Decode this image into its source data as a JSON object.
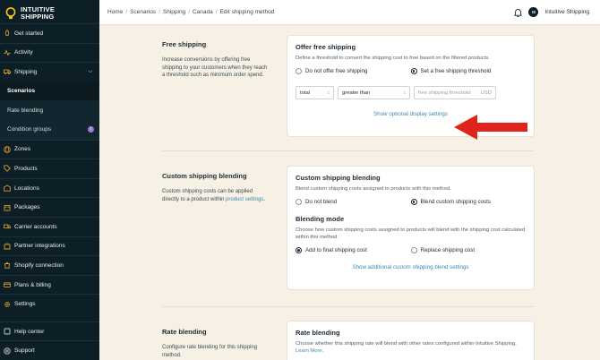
{
  "brand": {
    "line1": "INTUITIVE",
    "line2": "SHIPPING"
  },
  "sidebar": {
    "items": [
      {
        "label": "Get started",
        "icon": "rocket-icon"
      },
      {
        "label": "Activity",
        "icon": "activity-icon"
      },
      {
        "label": "Shipping",
        "icon": "truck-icon"
      }
    ],
    "sub_items": [
      {
        "label": "Scenarios"
      },
      {
        "label": "Rate blending"
      },
      {
        "label": "Condition groups",
        "badge": "i"
      }
    ],
    "items2": [
      {
        "label": "Zones",
        "icon": "globe-icon"
      },
      {
        "label": "Products",
        "icon": "tag-icon"
      },
      {
        "label": "Locations",
        "icon": "warehouse-icon"
      },
      {
        "label": "Packages",
        "icon": "box-icon"
      },
      {
        "label": "Carrier accounts",
        "icon": "truck-icon"
      },
      {
        "label": "Partner integrations",
        "icon": "puzzle-icon"
      },
      {
        "label": "Shopify connection",
        "icon": "shopify-icon"
      },
      {
        "label": "Plans & billing",
        "icon": "card-icon"
      },
      {
        "label": "Settings",
        "icon": "gear-icon"
      }
    ],
    "bottom": [
      {
        "label": "Help center",
        "icon": "help-icon"
      },
      {
        "label": "Support",
        "icon": "support-icon"
      }
    ]
  },
  "breadcrumb": [
    "Home",
    "Scenarios",
    "Shipping",
    "Canada",
    "Edit shipping method"
  ],
  "user": {
    "initials": "IS",
    "name": "Intuitive Shipping"
  },
  "free_shipping": {
    "title": "Free shipping",
    "desc": "Increase conversions by offering free shipping to your customers when they reach a threshold such as minimum order spend.",
    "card_title": "Offer free shipping",
    "card_desc": "Define a threshold to convert the shipping cost to free based on the filtered products.",
    "opt1": "Do not offer free shipping",
    "opt2": "Set a free shipping threshold",
    "select1": "total",
    "select2": "greater than",
    "input_placeholder": "free shipping threshold",
    "input_unit": "USD",
    "link": "Show optional display settings"
  },
  "custom_blending": {
    "title": "Custom shipping blending",
    "desc_pre": "Custom shipping costs can be applied directly to a product within ",
    "desc_link": "product settings",
    "desc_post": ".",
    "card_title": "Custom shipping blending",
    "card_desc": "Blend custom shipping costs assigned to products with this method.",
    "opt1": "Do not blend",
    "opt2": "Blend custom shipping costs",
    "mode_title": "Blending mode",
    "mode_desc": "Choose how custom shipping costs assigned to products will blend with the shipping cost calculated within this method.",
    "mode_opt1": "Add to final shipping cost",
    "mode_opt2": "Replace shipping cost",
    "link": "Show additional custom shipping blend settings"
  },
  "rate_blending": {
    "title": "Rate blending",
    "desc": "Configure rate blending for this shipping method.",
    "card_title": "Rate blending",
    "card_desc": "Choose whether this shipping rate will blend with other rates configured within Intuitive Shipping.",
    "card_link": "Learn More."
  },
  "colors": {
    "sidebar": "#0d1f26",
    "accent": "#3d8ab0",
    "annotation": "#e0241b",
    "background": "#f6f1e4"
  }
}
